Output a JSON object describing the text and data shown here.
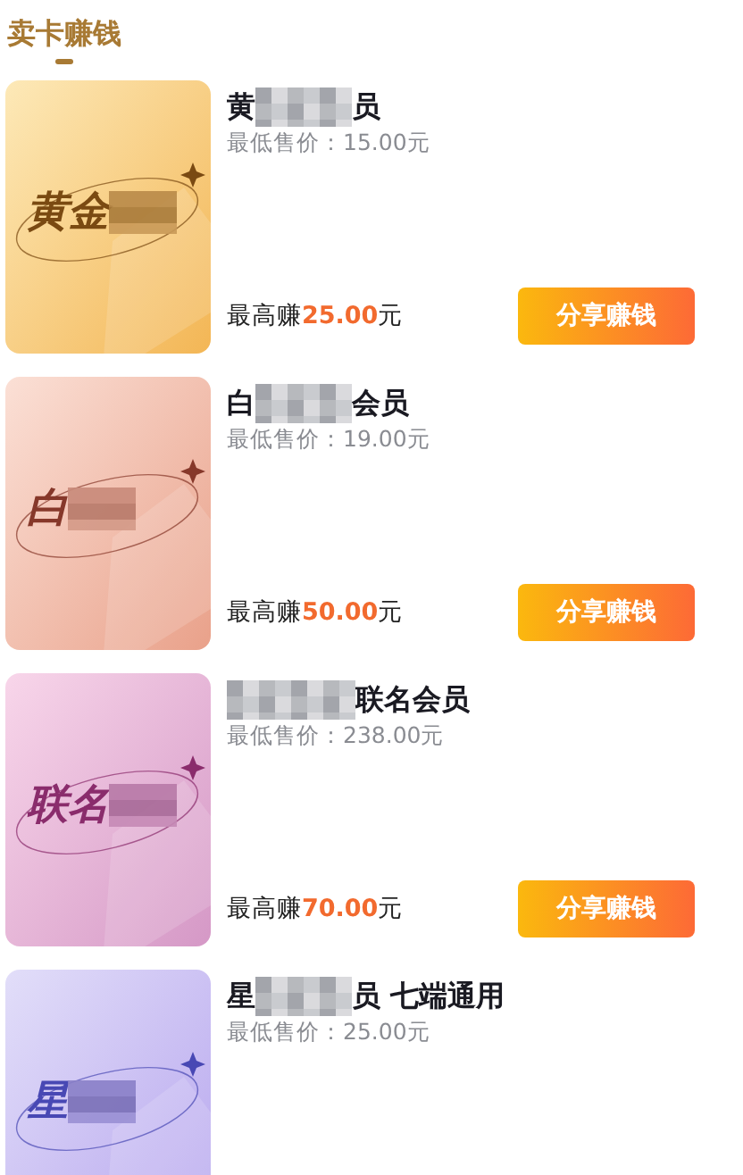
{
  "header": {
    "title": "卖卡赚钱"
  },
  "cards": [
    {
      "kind": "gold",
      "art_text": "黄金",
      "title_start": "黄",
      "title_end": "员",
      "min_price": "最低售价：15.00元",
      "earn_label": "最高赚",
      "earn_amount": "25.00",
      "earn_unit": "元",
      "button": "分享赚钱"
    },
    {
      "kind": "rose",
      "art_text": "白",
      "title_start": "白",
      "title_end": "会员",
      "min_price": "最低售价：19.00元",
      "earn_label": "最高赚",
      "earn_amount": "50.00",
      "earn_unit": "元",
      "button": "分享赚钱"
    },
    {
      "kind": "orchid",
      "art_text": "联名",
      "title_end": "联名会员",
      "min_price": "最低售价：238.00元",
      "earn_label": "最高赚",
      "earn_amount": "70.00",
      "earn_unit": "元",
      "button": "分享赚钱"
    },
    {
      "kind": "lilac",
      "art_text": "星",
      "title_start": "星",
      "title_end": "员 七端通用",
      "min_price": "最低售价：25.00元"
    }
  ]
}
